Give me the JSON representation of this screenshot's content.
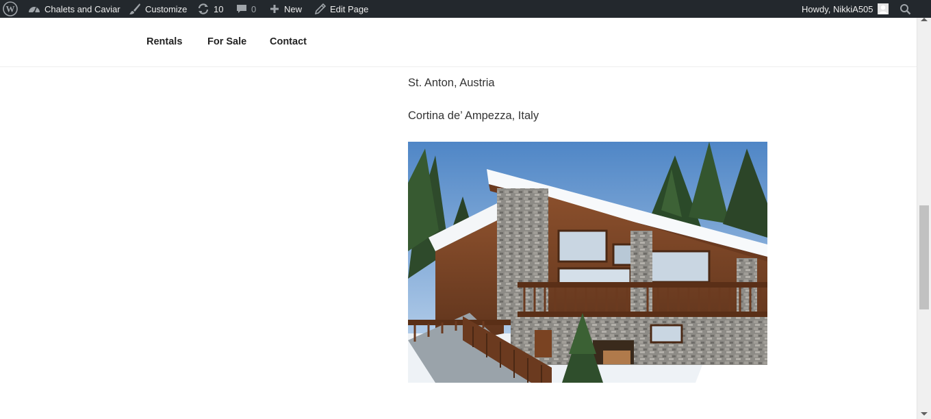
{
  "admin_bar": {
    "site_name": "Chalets and Caviar",
    "customize": "Customize",
    "updates_count": "10",
    "comments_count": "0",
    "new": "New",
    "edit_page": "Edit Page",
    "howdy": "Howdy, NikkiA505",
    "icons": [
      "wordpress-logo-icon",
      "dashboard-icon",
      "brush-icon",
      "updates-icon",
      "comments-icon",
      "plus-icon",
      "pencil-icon",
      "avatar-icon",
      "search-icon"
    ]
  },
  "nav": {
    "items": [
      {
        "label": "Rentals"
      },
      {
        "label": "For Sale"
      },
      {
        "label": "Contact"
      }
    ]
  },
  "content": {
    "locations": [
      "St. Anton, Austria",
      "Cortina de’ Ampezza, Italy"
    ]
  },
  "colors": {
    "admin_bar_bg": "#23282d",
    "admin_bar_text": "#eeeeee",
    "body_text": "#333333",
    "nav_text": "#222222"
  }
}
